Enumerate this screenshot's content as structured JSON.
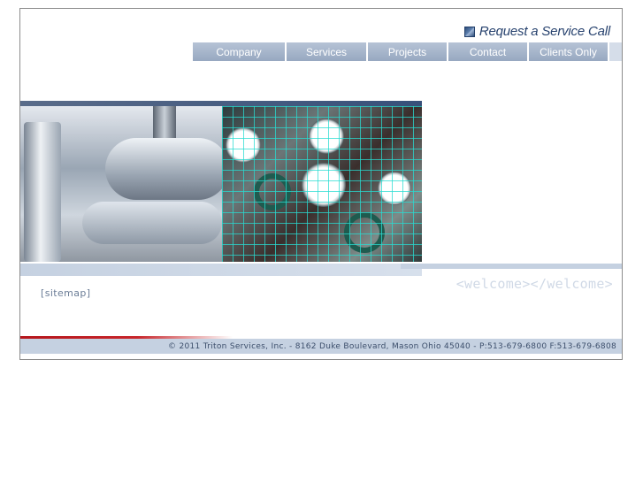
{
  "header": {
    "request_service": {
      "label": "Request a Service Call",
      "icon": "service-call-icon"
    }
  },
  "nav": {
    "items": [
      {
        "label": "Company"
      },
      {
        "label": "Services"
      },
      {
        "label": "Projects"
      },
      {
        "label": "Contact"
      },
      {
        "label": "Clients Only"
      }
    ]
  },
  "hero": {
    "image_left": "industrial-pipes-image",
    "image_right": "pressure-gauges-image"
  },
  "body": {
    "welcome": "<welcome></welcome>",
    "sitemap": "[sitemap]"
  },
  "footer": {
    "text": "© 2011 Triton Services, Inc. - 8162 Duke Boulevard, Mason Ohio 45040 - P:513-679-6800 F:513-679-6808"
  },
  "colors": {
    "nav_bg": "#a9b8cd",
    "accent_blue": "#27426e",
    "band": "#c5d1e1",
    "red_rule": "#c8262b",
    "grid_cyan": "#28dcd2"
  }
}
